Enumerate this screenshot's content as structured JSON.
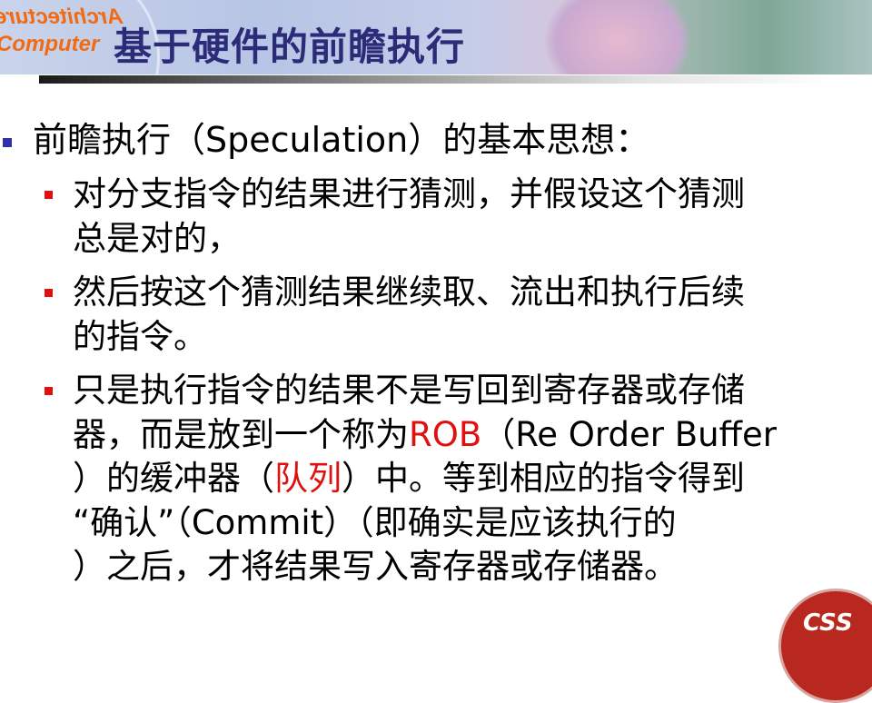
{
  "header": {
    "logo_line1": "Architecture",
    "logo_line2": "Computer",
    "title": "基于硬件的前瞻执行"
  },
  "main": {
    "text": "前瞻执行（Speculation）的基本思想：",
    "subs": [
      {
        "lines": [
          [
            {
              "t": "对分支指令的结果进行猜测，并假设这个猜测"
            }
          ],
          [
            {
              "t": "总是对的，"
            }
          ]
        ]
      },
      {
        "lines": [
          [
            {
              "t": "然后按这个猜测结果继续取、流出和执行后续"
            }
          ],
          [
            {
              "t": "的指令。"
            }
          ]
        ]
      },
      {
        "lines": [
          [
            {
              "t": "只是执行指令的结果不是写回到寄存器或存储"
            }
          ],
          [
            {
              "t": "器，而是放到一个称为"
            },
            {
              "t": "ROB",
              "red": true
            },
            {
              "t": "（Re Order Buffer"
            }
          ],
          [
            {
              "t": "）的缓冲器（"
            },
            {
              "t": "队列",
              "red": true
            },
            {
              "t": "）中。等到相应的指令得到"
            }
          ],
          [
            {
              "t": "“确认”（Commit）（即确实是应该执行的"
            }
          ],
          [
            {
              "t": "）之后，才将结果写入寄存器或存储器。"
            }
          ]
        ]
      }
    ]
  },
  "seal": {
    "text": "CSS"
  },
  "colors": {
    "title": "#2b2b78",
    "bullet_main": "#2f2fb0",
    "bullet_sub": "#e01010",
    "highlight": "#e01010"
  }
}
